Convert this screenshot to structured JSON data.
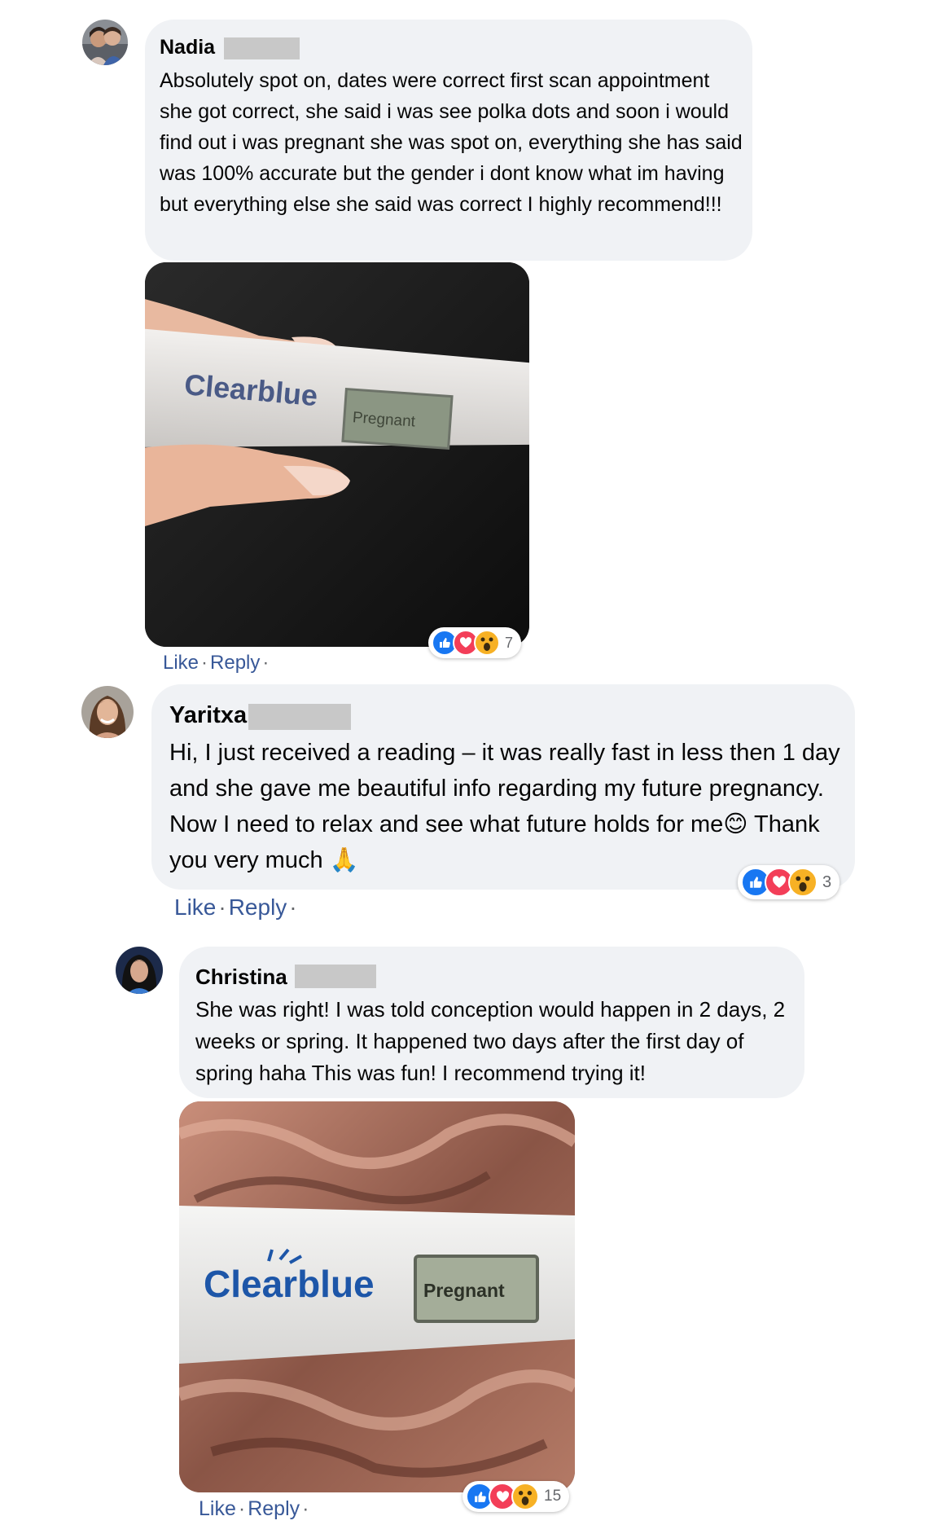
{
  "comments": [
    {
      "author": "Nadia",
      "text": "Absolutely spot on, dates were correct first scan appointment she got correct, she said i was see polka dots and soon i would find out i was pregnant she was spot on, everything she has said was 100% accurate but the gender i dont know what im having but everything else she said was correct I highly recommend!!!",
      "photo": {
        "brand": "Clearblue",
        "display": "Pregnant"
      },
      "reaction_count": "7",
      "like_label": "Like",
      "reply_label": "Reply"
    },
    {
      "author": "Yaritxa",
      "text": "Hi, I just received a reading – it was really fast in less then 1 day and she gave me beautiful info regarding my future pregnancy. Now I need to relax and see what future holds for me😊 Thank you very much 🙏",
      "reaction_count": "3",
      "like_label": "Like",
      "reply_label": "Reply"
    },
    {
      "author": "Christina",
      "text": "She was right! I was told conception would happen in 2 days, 2 weeks or spring. It happened two days after the first day of spring haha This was fun! I recommend trying it!",
      "photo": {
        "brand": "Clearblue",
        "display": "Pregnant"
      },
      "reaction_count": "15",
      "like_label": "Like",
      "reply_label": "Reply"
    }
  ],
  "reaction_icons": [
    "like-icon",
    "love-icon",
    "wow-icon"
  ],
  "colors": {
    "bubble": "#f0f2f5",
    "link": "#385898",
    "like": "#1877f2",
    "love": "#f33e58",
    "wow": "#f7b125"
  }
}
